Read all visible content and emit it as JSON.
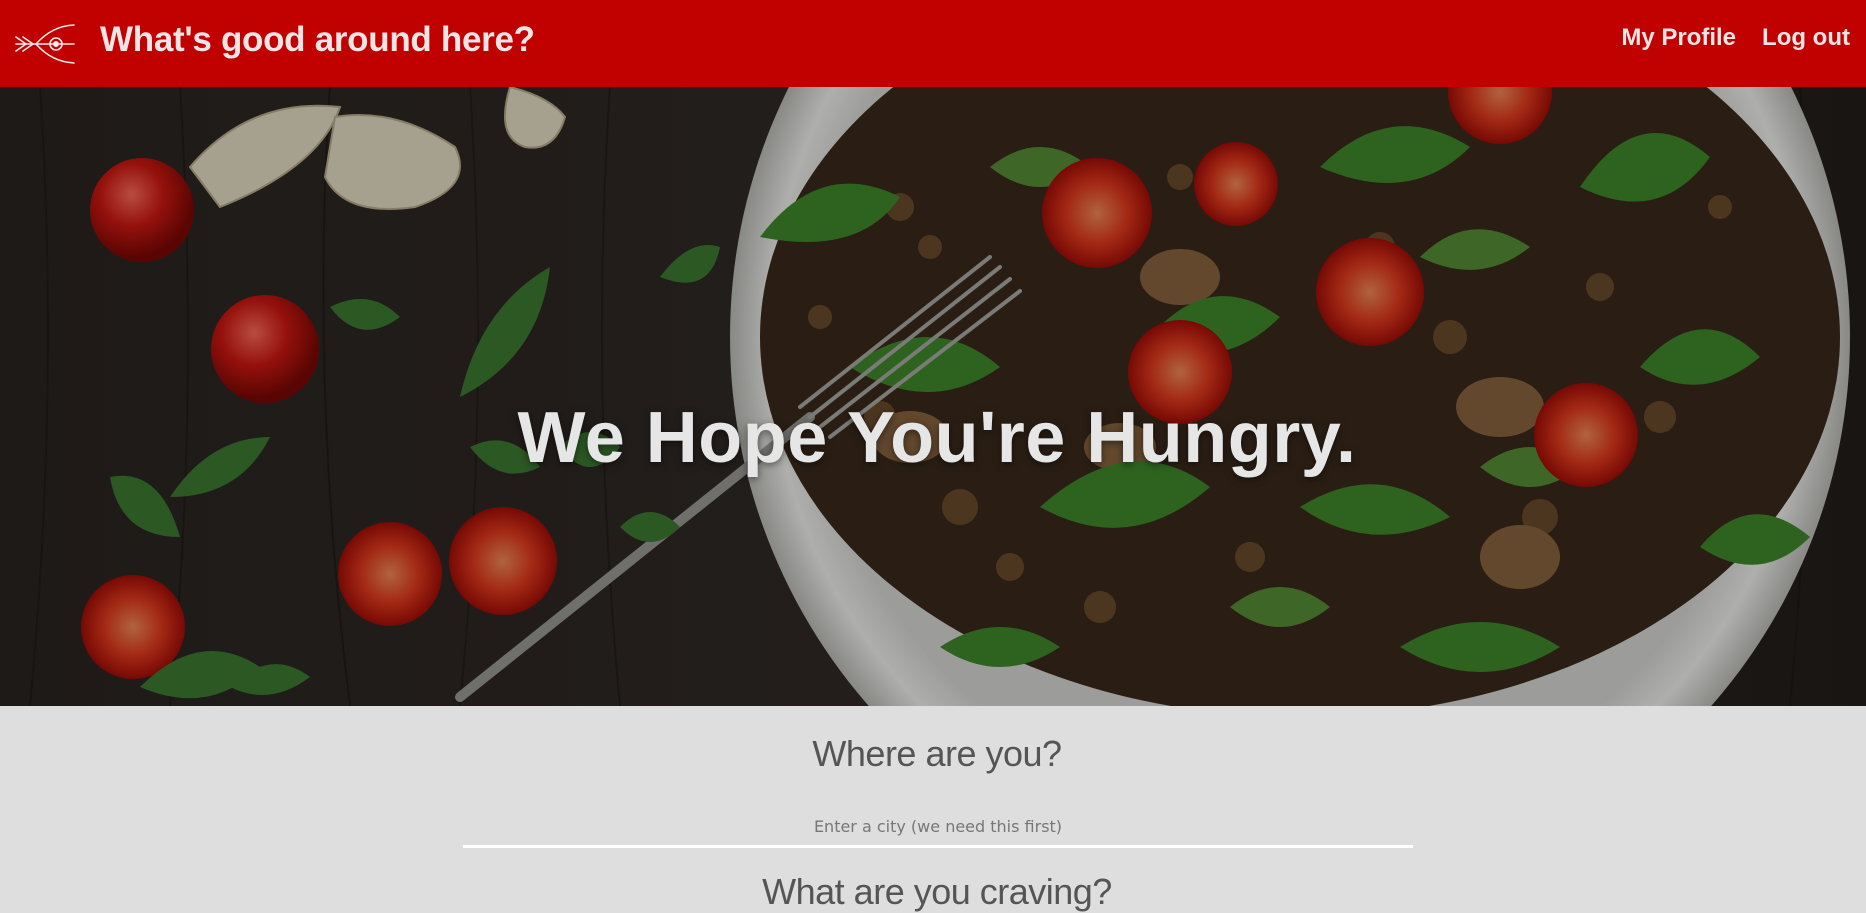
{
  "navbar": {
    "title": "What's good around here?",
    "logo_icon": "eye-arrow-logo-icon",
    "links": [
      {
        "label": "My Profile"
      },
      {
        "label": "Log out"
      }
    ],
    "background_color": "#c10000"
  },
  "hero": {
    "headline": "We Hope You're Hungry.",
    "image_subject": "salad-plate-with-tomatoes-and-fork"
  },
  "search": {
    "where_heading": "Where are you?",
    "city_placeholder": "Enter a city (we need this first)",
    "city_value": "",
    "craving_heading": "What are you craving?"
  }
}
